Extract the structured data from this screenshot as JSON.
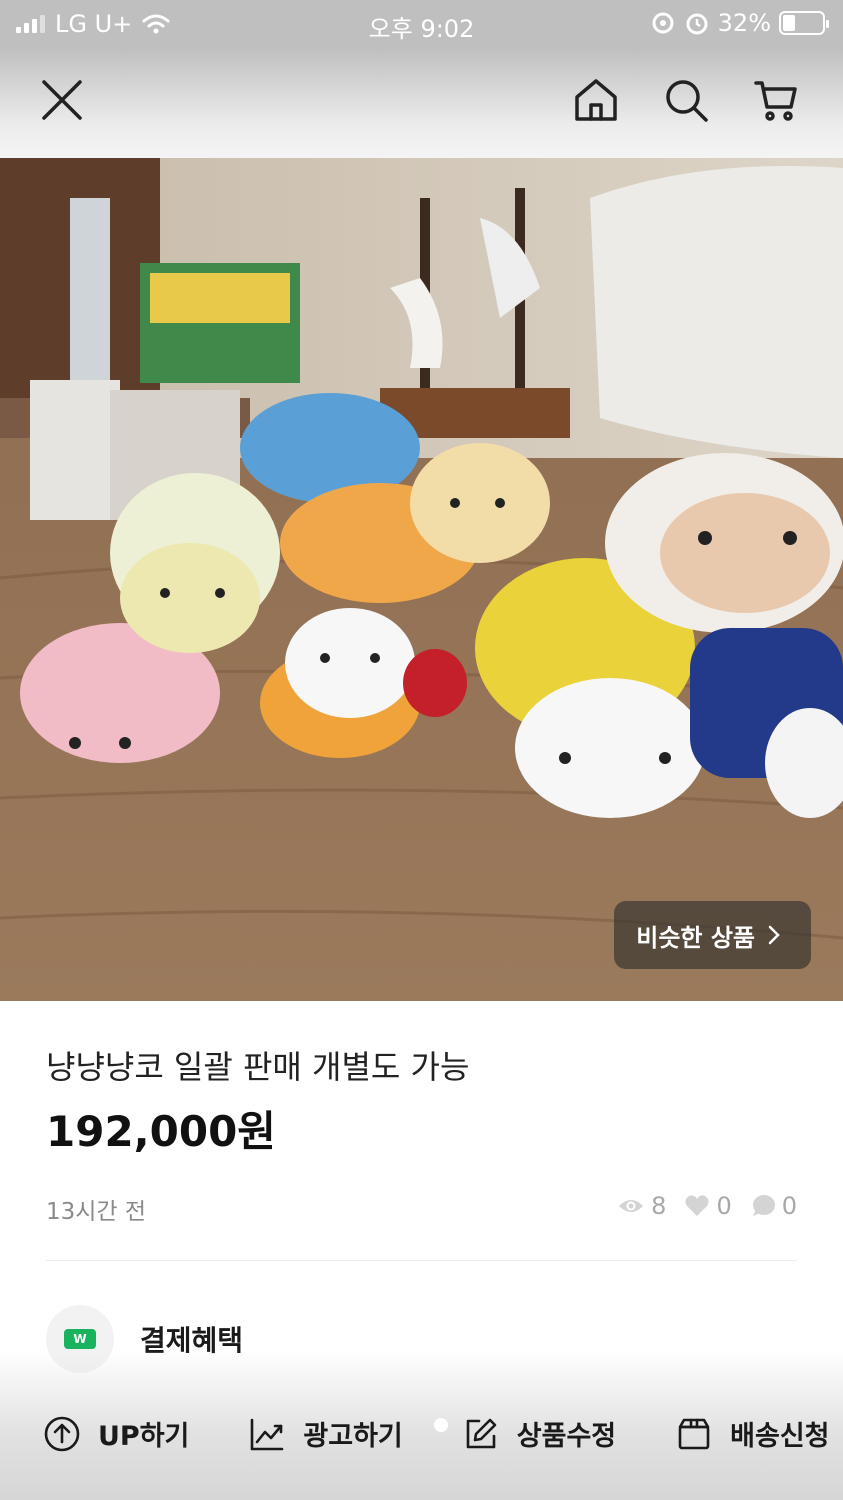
{
  "status_bar": {
    "carrier": "LG U+",
    "time": "오후 9:02",
    "battery": "32%",
    "battery_level": 0.32
  },
  "nav": {
    "icons": [
      "close-icon",
      "home-icon",
      "search-icon",
      "cart-icon"
    ]
  },
  "photo": {
    "similar_label": "비슷한 상품"
  },
  "product": {
    "title": "냥냥냥코 일괄 판매 개별도 가능",
    "price": "192,000원",
    "time_ago": "13시간 전",
    "views": "8",
    "likes": "0",
    "chats": "0"
  },
  "benefit": {
    "label": "결제혜택",
    "icon_text": "W"
  },
  "actions": [
    {
      "label": "UP하기",
      "icon": "up-arrow-icon"
    },
    {
      "label": "광고하기",
      "icon": "chart-icon"
    },
    {
      "label": "상품수정",
      "icon": "edit-icon"
    },
    {
      "label": "배송신청",
      "icon": "box-icon"
    }
  ],
  "colors": {
    "accent_green": "#19b35e",
    "status_bar": "#bfbfbf"
  }
}
